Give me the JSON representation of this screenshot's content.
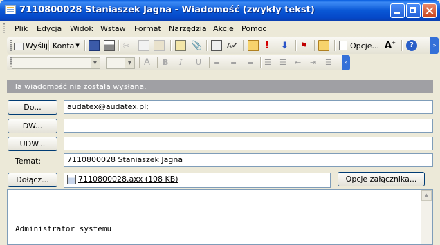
{
  "window": {
    "title": "7110800028 Staniaszek Jagna - Wiadomość (zwykły tekst)"
  },
  "menu": [
    {
      "id": "plik",
      "label": "Plik"
    },
    {
      "id": "edycja",
      "label": "Edycja"
    },
    {
      "id": "widok",
      "label": "Widok"
    },
    {
      "id": "wstaw",
      "label": "Wstaw"
    },
    {
      "id": "format",
      "label": "Format"
    },
    {
      "id": "narzedzia",
      "label": "Narzędzia"
    },
    {
      "id": "akcje",
      "label": "Akcje"
    },
    {
      "id": "pomoc",
      "label": "Pomoc"
    }
  ],
  "toolbar": {
    "send_label": "Wyślij",
    "account_label": "Konta",
    "options_label": "Opcje..."
  },
  "format_toolbar": {
    "style_value": "",
    "size_value": ""
  },
  "info_bar": "Ta wiadomość nie została wysłana.",
  "header": {
    "to_button": "Do...",
    "to_value": "audatex@audatex.pl;",
    "cc_button": "DW...",
    "cc_value": "",
    "bcc_button": "UDW...",
    "bcc_value": "",
    "subject_label": "Temat:",
    "subject_value": "7110800028 Staniaszek Jagna",
    "attach_button": "Dołącz...",
    "attachment": "7110800028.axx (108 KB)",
    "attach_options_button": "Opcje załącznika..."
  },
  "message_body": "Administrator systemu",
  "colors": {
    "title_bar": "#0A58D6",
    "window_bg": "#ECE9D8",
    "info_bar": "#A0A0A4"
  }
}
